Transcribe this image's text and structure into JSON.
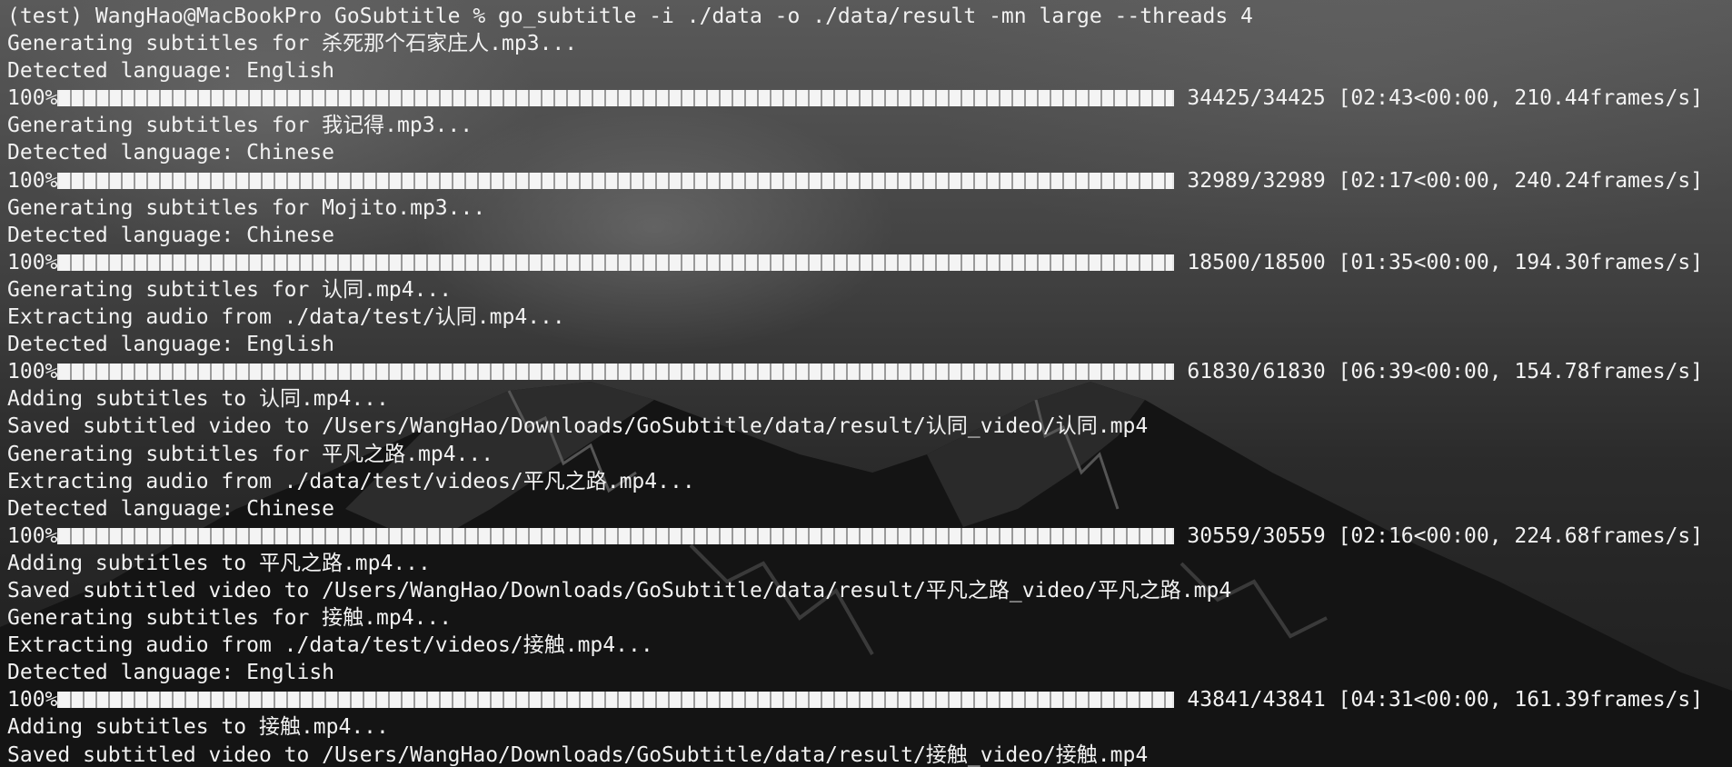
{
  "terminal": {
    "prompt": "(test) WangHao@MacBookPro GoSubtitle % ",
    "command": "go_subtitle -i ./data -o ./data/result -mn large --threads 4",
    "lines": [
      {
        "type": "text",
        "text": "Generating subtitles for 杀死那个石家庄人.mp3..."
      },
      {
        "type": "text",
        "text": "Detected language: English"
      },
      {
        "type": "progress",
        "percent_label": "100%",
        "progress": 1.0,
        "stats": "34425/34425 [02:43<00:00, 210.44frames/s]"
      },
      {
        "type": "text",
        "text": "Generating subtitles for 我记得.mp3..."
      },
      {
        "type": "text",
        "text": "Detected language: Chinese"
      },
      {
        "type": "progress",
        "percent_label": "100%",
        "progress": 1.0,
        "stats": "32989/32989 [02:17<00:00, 240.24frames/s]"
      },
      {
        "type": "text",
        "text": "Generating subtitles for Mojito.mp3..."
      },
      {
        "type": "text",
        "text": "Detected language: Chinese"
      },
      {
        "type": "progress",
        "percent_label": "100%",
        "progress": 1.0,
        "stats": "18500/18500 [01:35<00:00, 194.30frames/s]"
      },
      {
        "type": "text",
        "text": "Generating subtitles for 认同.mp4..."
      },
      {
        "type": "text",
        "text": "Extracting audio from ./data/test/认同.mp4..."
      },
      {
        "type": "text",
        "text": "Detected language: English"
      },
      {
        "type": "progress",
        "percent_label": "100%",
        "progress": 1.0,
        "stats": "61830/61830 [06:39<00:00, 154.78frames/s]"
      },
      {
        "type": "text",
        "text": "Adding subtitles to 认同.mp4..."
      },
      {
        "type": "text",
        "text": "Saved subtitled video to /Users/WangHao/Downloads/GoSubtitle/data/result/认同_video/认同.mp4"
      },
      {
        "type": "text",
        "text": "Generating subtitles for 平凡之路.mp4..."
      },
      {
        "type": "text",
        "text": "Extracting audio from ./data/test/videos/平凡之路.mp4..."
      },
      {
        "type": "text",
        "text": "Detected language: Chinese"
      },
      {
        "type": "progress",
        "percent_label": "100%",
        "progress": 1.0,
        "stats": "30559/30559 [02:16<00:00, 224.68frames/s]"
      },
      {
        "type": "text",
        "text": "Adding subtitles to 平凡之路.mp4..."
      },
      {
        "type": "text",
        "text": "Saved subtitled video to /Users/WangHao/Downloads/GoSubtitle/data/result/平凡之路_video/平凡之路.mp4"
      },
      {
        "type": "text",
        "text": "Generating subtitles for 接触.mp4..."
      },
      {
        "type": "text",
        "text": "Extracting audio from ./data/test/videos/接触.mp4..."
      },
      {
        "type": "text",
        "text": "Detected language: English"
      },
      {
        "type": "progress",
        "percent_label": "100%",
        "progress": 1.0,
        "stats": "43841/43841 [04:31<00:00, 161.39frames/s]"
      },
      {
        "type": "text",
        "text": "Adding subtitles to 接触.mp4..."
      },
      {
        "type": "text",
        "text": "Saved subtitled video to /Users/WangHao/Downloads/GoSubtitle/data/result/接触_video/接触.mp4"
      }
    ]
  },
  "colors": {
    "text": "#f2f2f2",
    "bar_cell": "#f4f4f4"
  }
}
